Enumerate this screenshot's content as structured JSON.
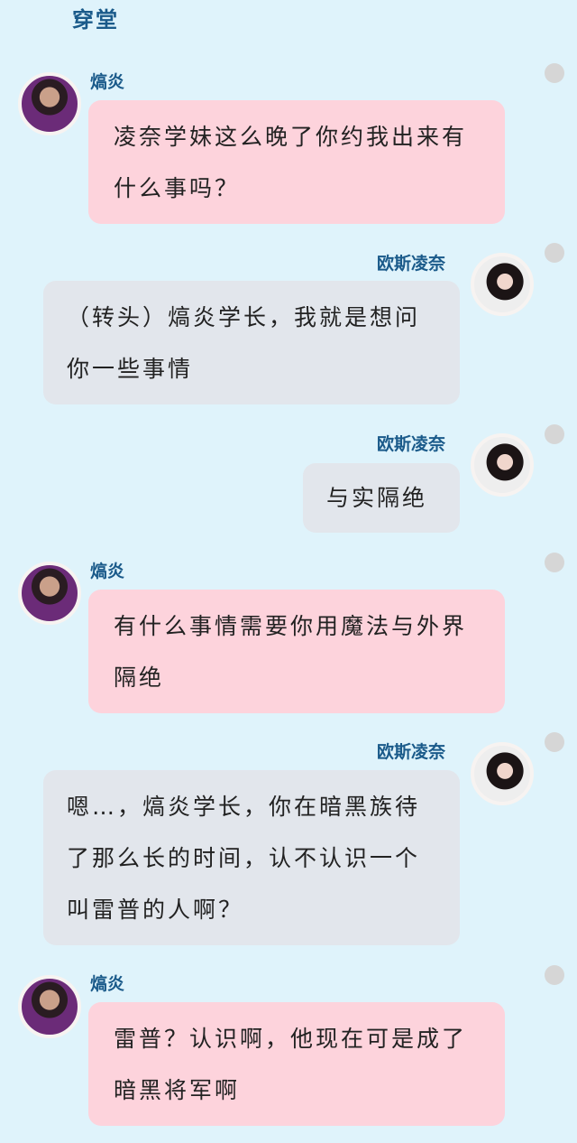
{
  "header": {
    "title": "穿堂"
  },
  "messages": [
    {
      "sender": "熇炎",
      "side": "left",
      "style": "pink",
      "text": "凌奈学妹这么晚了你约我出来有什么事吗？"
    },
    {
      "sender": "欧斯凌奈",
      "side": "right",
      "style": "gray",
      "text": "（转头）熇炎学长，我就是想问你一些事情"
    },
    {
      "sender": "欧斯凌奈",
      "side": "right",
      "style": "gray",
      "text": "与实隔绝"
    },
    {
      "sender": "熇炎",
      "side": "left",
      "style": "pink",
      "text": "有什么事情需要你用魔法与外界隔绝"
    },
    {
      "sender": "欧斯凌奈",
      "side": "right",
      "style": "gray",
      "text": "嗯…，熇炎学长，你在暗黑族待了那么长的时间，认不认识一个叫雷普的人啊？"
    },
    {
      "sender": "熇炎",
      "side": "left",
      "style": "pink",
      "text": "雷普？认识啊，他现在可是成了暗黑将军啊"
    }
  ],
  "icons": {
    "avatar_male": "male-avatar-icon",
    "avatar_female": "female-avatar-icon",
    "status_dot": "status-dot-icon"
  },
  "colors": {
    "background": "#dff3fb",
    "pink_bubble": "#fdd3dc",
    "gray_bubble": "#e2e6ec",
    "name_text": "#1a5a8a"
  }
}
